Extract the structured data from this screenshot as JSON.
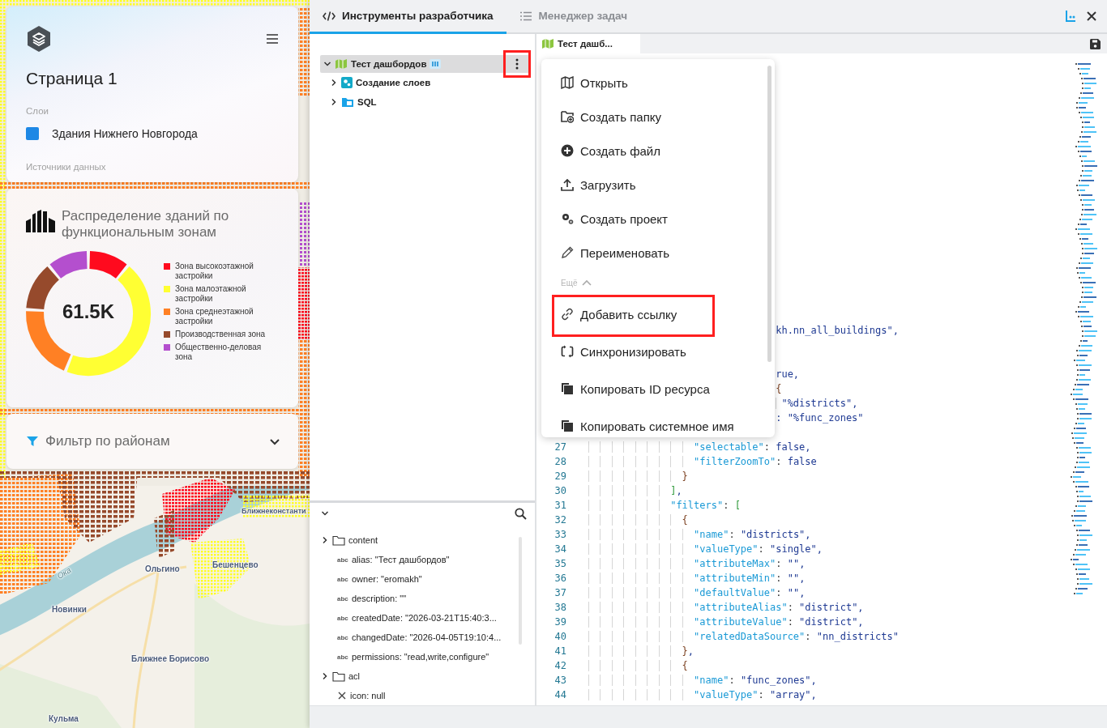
{
  "map": {
    "labels": [
      "Ближнеконстанти",
      "Ока",
      "Ольгино",
      "Бешенцево",
      "Новинки",
      "Ближнее Борисово",
      "Кульма"
    ]
  },
  "page_card": {
    "title": "Страница 1",
    "layers_heading": "Слои",
    "layers": [
      {
        "name": "Здания Нижнего Новгорода",
        "color": "#1e88e5"
      }
    ],
    "sources_heading": "Источники данных"
  },
  "chart_card": {
    "title": "Распределение зданий по функциональным зонам",
    "total": "61.5K",
    "legend": [
      {
        "label": "Зона высокоэтажной застройки",
        "color": "#ff0a1e"
      },
      {
        "label": "Зона малоэтажной застройки",
        "color": "#ffff33"
      },
      {
        "label": "Зона среднеэтажной застройки",
        "color": "#ff8024"
      },
      {
        "label": "Производственная зона",
        "color": "#964a2c"
      },
      {
        "label": "Общественно-деловая зона",
        "color": "#b44fce"
      }
    ]
  },
  "filter_card": {
    "title": "Фильтр по районам",
    "expanded": false
  },
  "dev_tabs": [
    {
      "label": "Инструменты разработчика",
      "selected": true,
      "kind": "code"
    },
    {
      "label": "Менеджер задач",
      "selected": false,
      "kind": "list"
    }
  ],
  "tree": [
    {
      "label": "Тест дашбордов",
      "kind": "dashboard",
      "expanded": true,
      "selected": true,
      "children": [
        {
          "label": "Создание слоев",
          "kind": "project",
          "expanded": false
        },
        {
          "label": "SQL",
          "kind": "folder",
          "expanded": false
        }
      ]
    }
  ],
  "tree_actions": {
    "highlighted": true
  },
  "context_menu": {
    "items": [
      {
        "label": "Открыть",
        "kind": "map",
        "highlighted": false
      },
      {
        "label": "Создать папку",
        "kind": "folder-add",
        "highlighted": false
      },
      {
        "label": "Создать файл",
        "kind": "add",
        "highlighted": false
      },
      {
        "label": "Загрузить",
        "kind": "upload",
        "highlighted": false
      },
      {
        "label": "Создать проект",
        "kind": "gears",
        "highlighted": false
      },
      {
        "label": "Переименовать",
        "kind": "pencil",
        "highlighted": false
      }
    ],
    "more_label": "Ещё",
    "more_expanded": true,
    "more_items": [
      {
        "label": "Добавить ссылку",
        "kind": "link",
        "highlighted": true
      },
      {
        "label": "Синхронизировать",
        "kind": "sync",
        "highlighted": false
      },
      {
        "label": "Копировать ID ресурса",
        "kind": "copy",
        "highlighted": false
      },
      {
        "label": "Копировать системное имя",
        "kind": "copy",
        "highlighted": false
      }
    ]
  },
  "properties": {
    "items": [
      {
        "kind": "object",
        "label": "content",
        "expanded": false
      },
      {
        "kind": "string",
        "badge": "abc",
        "label": "alias: \"Тест дашбордов\""
      },
      {
        "kind": "string",
        "badge": "abc",
        "label": "owner: \"eromakh\""
      },
      {
        "kind": "string",
        "badge": "abc",
        "label": "description: \"\""
      },
      {
        "kind": "string",
        "badge": "abc",
        "label": "createdDate: \"2026-03-21T15:40:3..."
      },
      {
        "kind": "string",
        "badge": "abc",
        "label": "changedDate: \"2026-04-05T19:10:4..."
      },
      {
        "kind": "string",
        "badge": "abc",
        "label": "permissions: \"read,write,configure\""
      },
      {
        "kind": "object",
        "label": "acl",
        "expanded": false
      },
      {
        "kind": "null",
        "label": "icon: null"
      }
    ]
  },
  "editor": {
    "tab": {
      "label": "Тест дашб...",
      "selected": true
    },
    "fragments": [
      "                                kh.nn_all_buildings\",",
      "                                rue,",
      "                                {",
      "                                 \"%districts\",",
      "                                : \"%func_zones\""
    ],
    "lines": [
      {
        "number": "27",
        "text": "                  \"selectable\": false,"
      },
      {
        "number": "28",
        "text": "                  \"filterZoomTo\": false"
      },
      {
        "number": "29",
        "text": "                }"
      },
      {
        "number": "30",
        "text": "              ],"
      },
      {
        "number": "31",
        "text": "              \"filters\": ["
      },
      {
        "number": "32",
        "text": "                {"
      },
      {
        "number": "33",
        "text": "                  \"name\": \"districts\","
      },
      {
        "number": "34",
        "text": "                  \"valueType\": \"single\","
      },
      {
        "number": "35",
        "text": "                  \"attributeMax\": \"\","
      },
      {
        "number": "36",
        "text": "                  \"attributeMin\": \"\","
      },
      {
        "number": "37",
        "text": "                  \"defaultValue\": \"\","
      },
      {
        "number": "38",
        "text": "                  \"attributeAlias\": \"district\","
      },
      {
        "number": "39",
        "text": "                  \"attributeValue\": \"district\","
      },
      {
        "number": "40",
        "text": "                  \"relatedDataSource\": \"nn_districts\""
      },
      {
        "number": "41",
        "text": "                },"
      },
      {
        "number": "42",
        "text": "                {"
      },
      {
        "number": "43",
        "text": "                  \"name\": \"func_zones\","
      },
      {
        "number": "44",
        "text": "                  \"valueType\": \"array\","
      }
    ]
  }
}
